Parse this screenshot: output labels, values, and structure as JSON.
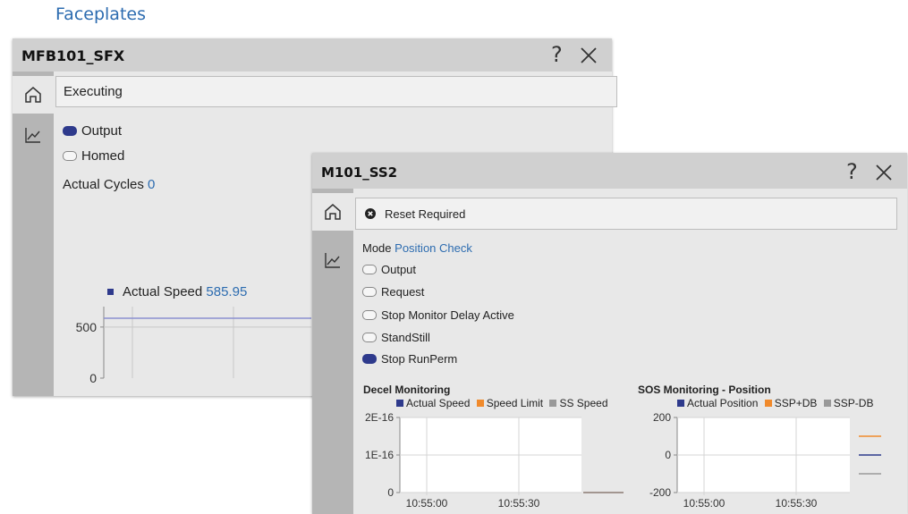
{
  "heading": "Faceplates",
  "faceplate1": {
    "title": "MFB101_SFX",
    "help": "?",
    "status": "Executing",
    "indicators": [
      {
        "label": "Output",
        "on": true
      },
      {
        "label": "Homed",
        "on": false
      }
    ],
    "cycles_label": "Actual Cycles",
    "cycles_value": "0",
    "trend": {
      "legend_label": "Actual Speed",
      "legend_value": "585.95",
      "legend_color": "#2e3a8c",
      "y_ticks": [
        "500",
        "0"
      ]
    }
  },
  "faceplate2": {
    "title": "M101_SS2",
    "help": "?",
    "status": "Reset Required",
    "mode_label": "Mode",
    "mode_value": "Position Check",
    "indicators": [
      {
        "label": "Output",
        "on": false
      },
      {
        "label": "Request",
        "on": false
      },
      {
        "label": "Stop Monitor Delay Active",
        "on": false
      },
      {
        "label": "StandStill",
        "on": false
      },
      {
        "label": "Stop RunPerm",
        "on": true
      }
    ]
  },
  "chart_data": [
    {
      "type": "line",
      "title": "Actual Speed",
      "series": [
        {
          "name": "Actual Speed",
          "color": "#2e3a8c",
          "values": [
            585.95,
            585.95
          ]
        }
      ],
      "y_tick_labels": [
        "500",
        "0"
      ],
      "ylim": [
        0,
        700
      ]
    },
    {
      "type": "line",
      "title": "Decel Monitoring",
      "x": [
        "10:55:00",
        "10:55:30"
      ],
      "series": [
        {
          "name": "Actual Speed",
          "color": "#2e3a8c",
          "values": [
            0,
            0
          ]
        },
        {
          "name": "Speed Limit",
          "color": "#f08a2c",
          "values": [
            0,
            0
          ]
        },
        {
          "name": "SS Speed",
          "color": "#999999",
          "values": [
            0,
            0
          ]
        }
      ],
      "y_tick_labels": [
        "2E-16",
        "1E-16",
        "0"
      ],
      "ylim": [
        0,
        2e-16
      ]
    },
    {
      "type": "line",
      "title": "SOS Monitoring - Position",
      "x": [
        "10:55:00",
        "10:55:30"
      ],
      "series": [
        {
          "name": "Actual Position",
          "color": "#2e3a8c",
          "values": [
            0,
            0
          ]
        },
        {
          "name": "SSP+DB",
          "color": "#f08a2c",
          "values": [
            100,
            100
          ]
        },
        {
          "name": "SSP-DB",
          "color": "#999999",
          "values": [
            -100,
            -100
          ]
        }
      ],
      "y_tick_labels": [
        "200",
        "0",
        "-200"
      ],
      "ylim": [
        -200,
        200
      ]
    }
  ]
}
